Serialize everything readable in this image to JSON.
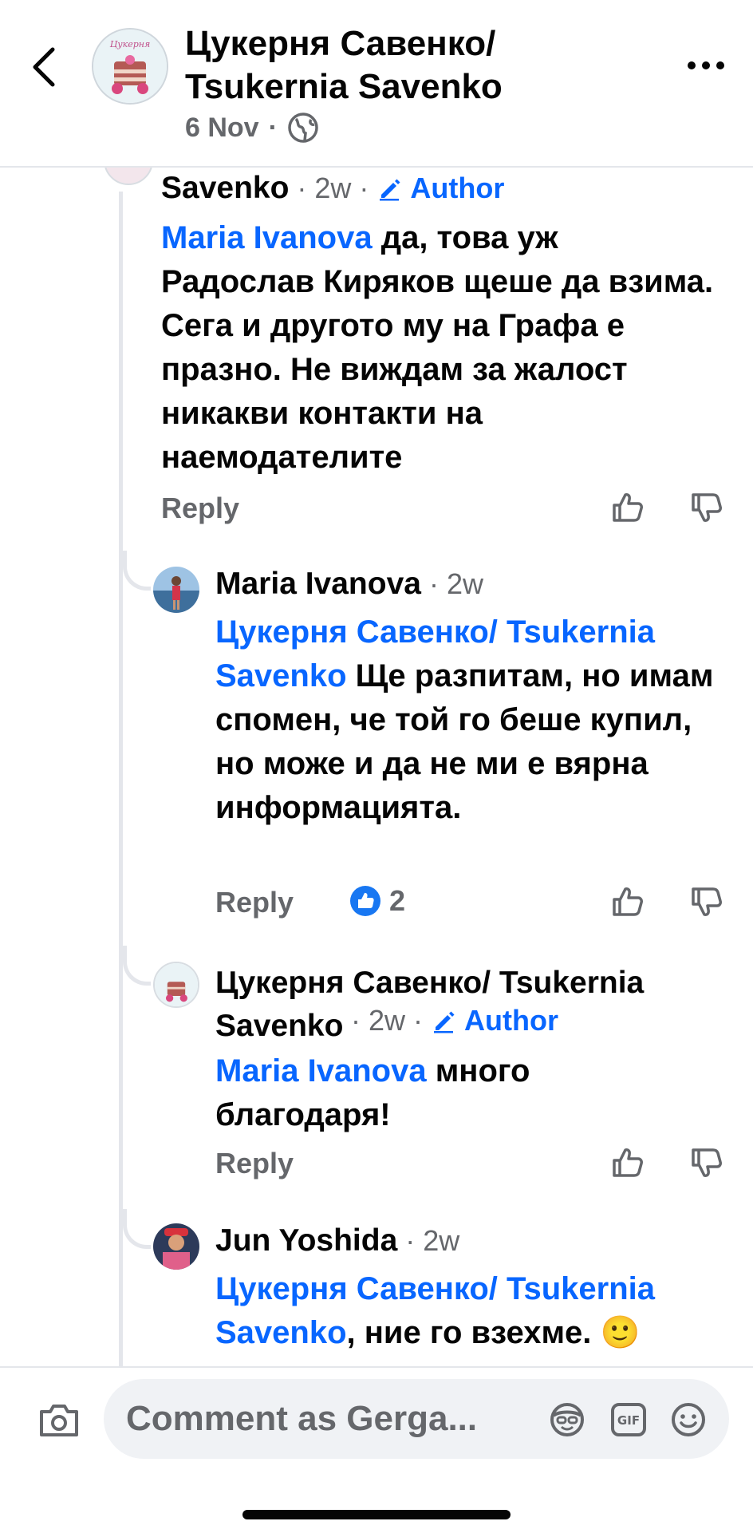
{
  "header": {
    "page_name": "Цукерня Савенко/ Tsukernia Savenko",
    "date": "6 Nov",
    "separator": "·"
  },
  "comments": [
    {
      "author": "Savenko",
      "time": "· 2w ·",
      "badge": "Author",
      "mention": "Maria Ivanova",
      "text": " да, това уж Радослав Киряков щеше да взима. Сега и другото му на Графа е празно. Не виждам за жалост никакви контакти на наемодателите",
      "reply": "Reply"
    },
    {
      "author": "Maria Ivanova",
      "time": "· 2w",
      "mention": "Цукерня Савенко/ Tsukernia Savenko",
      "text": " Ще разпитам, но имам спомен, че той го беше купил, но може и да не ми е вярна информацията.",
      "reply": "Reply",
      "reaction_count": "2"
    },
    {
      "author": "Цукерня Савенко/ Tsukernia Savenko",
      "time": "· 2w ·",
      "badge": "Author",
      "mention": "Maria Ivanova",
      "text": " много благодаря!",
      "reply": "Reply"
    },
    {
      "author": "Jun Yoshida",
      "time": "· 2w",
      "mention": "Цукерня Савенко/ Tsukernia Savenko",
      "text": ", ние го взехме. 🙂"
    }
  ],
  "composer": {
    "placeholder": "Comment as Gerga..."
  },
  "icons": {
    "back": "chevron-left-icon",
    "more": "more-dots-icon",
    "globe": "globe-icon",
    "pencil": "pencil-icon",
    "like": "thumbs-up-icon",
    "dislike": "thumbs-down-icon",
    "camera": "camera-icon",
    "avatar_sticker": "avatar-sticker-icon",
    "gif": "gif-icon",
    "emoji": "emoji-icon"
  },
  "colors": {
    "accent": "#0866ff",
    "secondary_text": "#65676b",
    "thread_line": "#e4e6eb"
  }
}
